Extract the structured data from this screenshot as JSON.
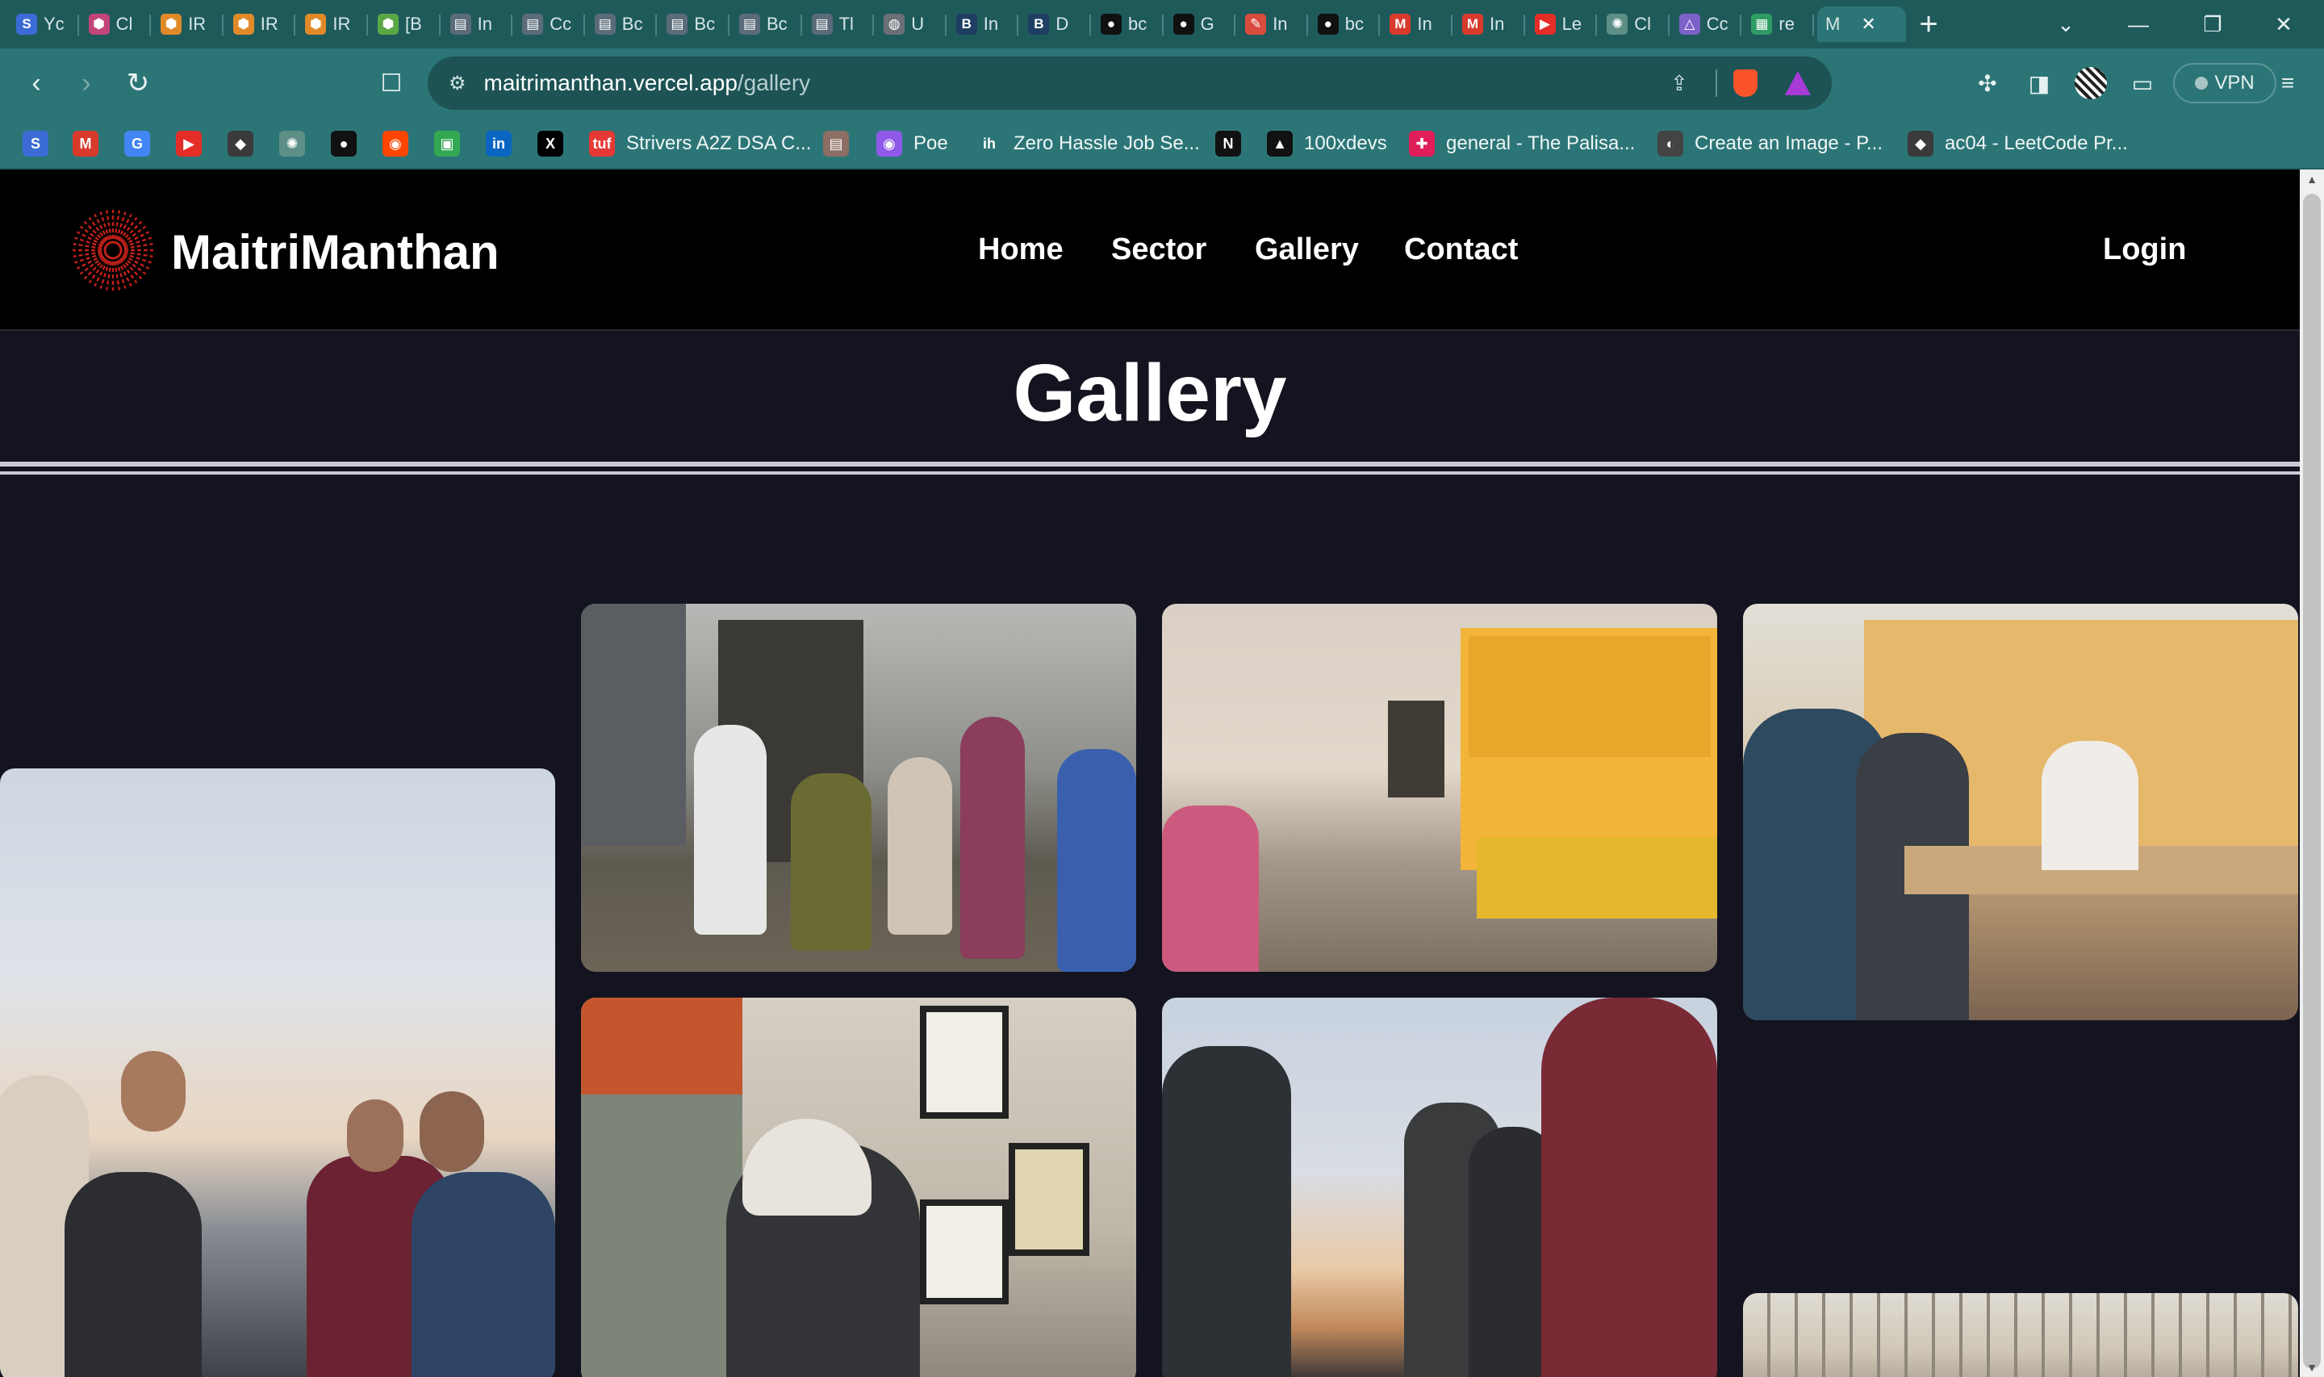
{
  "browser": {
    "tabs": [
      {
        "label": "Yc",
        "icon": "S",
        "color": "#3b6cd6"
      },
      {
        "label": "Cl",
        "icon": "⬢",
        "color": "#c2457a"
      },
      {
        "label": "IR",
        "icon": "⬢",
        "color": "#e08a2a"
      },
      {
        "label": "IR",
        "icon": "⬢",
        "color": "#e08a2a"
      },
      {
        "label": "IR",
        "icon": "⬢",
        "color": "#e08a2a"
      },
      {
        "label": "[B",
        "icon": "⬢",
        "color": "#5aa845"
      },
      {
        "label": "In",
        "icon": "▤",
        "color": "#5b6b7a"
      },
      {
        "label": "Cc",
        "icon": "▤",
        "color": "#5b6b7a"
      },
      {
        "label": "Bc",
        "icon": "▤",
        "color": "#5b6b7a"
      },
      {
        "label": "Bc",
        "icon": "▤",
        "color": "#5b6b7a"
      },
      {
        "label": "Bc",
        "icon": "▤",
        "color": "#5b6b7a"
      },
      {
        "label": "Tl",
        "icon": "▤",
        "color": "#5b6b7a"
      },
      {
        "label": "U",
        "icon": "◍",
        "color": "#6b6f76"
      },
      {
        "label": "In",
        "icon": "B",
        "color": "#1f3e63"
      },
      {
        "label": "D",
        "icon": "B",
        "color": "#1f3e63"
      },
      {
        "label": "bc",
        "icon": "●",
        "color": "#111111"
      },
      {
        "label": "G",
        "icon": "●",
        "color": "#111111"
      },
      {
        "label": "In",
        "icon": "✎",
        "color": "#d94b3d"
      },
      {
        "label": "bc",
        "icon": "●",
        "color": "#111111"
      },
      {
        "label": "In",
        "icon": "M",
        "color": "#d93a2b"
      },
      {
        "label": "In",
        "icon": "M",
        "color": "#d93a2b"
      },
      {
        "label": "Le",
        "icon": "▶",
        "color": "#e52d27"
      },
      {
        "label": "Cl",
        "icon": "✺",
        "color": "#5d8f86"
      },
      {
        "label": "Cc",
        "icon": "△",
        "color": "#7b62c8"
      },
      {
        "label": "re",
        "icon": "▦",
        "color": "#2f9c63"
      },
      {
        "label": "M",
        "icon": "",
        "color": "#2c7577"
      }
    ],
    "url_host": "maitrimanthan.vercel.app",
    "url_path": "/gallery",
    "vpn_label": "VPN",
    "bookmarks": [
      {
        "label": "",
        "icon": "S",
        "color": "#3b6cd6"
      },
      {
        "label": "",
        "icon": "M",
        "color": "#d93a2b"
      },
      {
        "label": "",
        "icon": "G",
        "color": "#4285f4"
      },
      {
        "label": "",
        "icon": "▶",
        "color": "#e52d27"
      },
      {
        "label": "",
        "icon": "◆",
        "color": "#3a3a3a"
      },
      {
        "label": "",
        "icon": "✺",
        "color": "#5d8f86"
      },
      {
        "label": "",
        "icon": "●",
        "color": "#111111"
      },
      {
        "label": "",
        "icon": "◉",
        "color": "#ff4500"
      },
      {
        "label": "",
        "icon": "▣",
        "color": "#34a853"
      },
      {
        "label": "",
        "icon": "in",
        "color": "#0a66c2"
      },
      {
        "label": "",
        "icon": "X",
        "color": "#000000"
      },
      {
        "label": "Strivers A2Z DSA C...",
        "icon": "tuf",
        "color": "#e53935"
      },
      {
        "label": "",
        "icon": "▤",
        "color": "#8d6e63"
      },
      {
        "label": "Poe",
        "icon": "◉",
        "color": "#8e59e8"
      },
      {
        "label": "Zero Hassle Job Se...",
        "icon": "ih",
        "color": "#2c7577"
      },
      {
        "label": "",
        "icon": "N",
        "color": "#111111"
      },
      {
        "label": "100xdevs",
        "icon": "▲",
        "color": "#111111"
      },
      {
        "label": "general - The Palisa...",
        "icon": "✚",
        "color": "#e01e5a"
      },
      {
        "label": "Create an Image - P...",
        "icon": "◐",
        "color": "#444444"
      },
      {
        "label": "ac04 - LeetCode Pr...",
        "icon": "◆",
        "color": "#3a3a3a"
      }
    ]
  },
  "site": {
    "brand": "MaitriManthan",
    "nav": {
      "home": "Home",
      "sector": "Sector",
      "gallery": "Gallery",
      "contact": "Contact"
    },
    "login": "Login",
    "page_title": "Gallery",
    "accent_color": "#c0201a",
    "background": "#131420"
  }
}
